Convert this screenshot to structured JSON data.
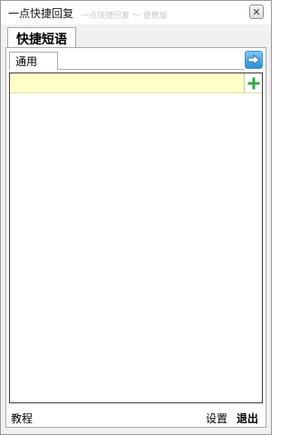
{
  "window": {
    "title": "一点快捷回复",
    "ghost_text": "一点快捷回复 ～ 便携版"
  },
  "outer_tab": {
    "label": "快捷短语"
  },
  "inner_tab": {
    "label": "通用"
  },
  "input": {
    "value": "",
    "placeholder": ""
  },
  "footer": {
    "tutorial": "教程",
    "settings": "设置",
    "quit": "退出"
  },
  "icons": {
    "close": "close-icon",
    "nav": "arrow-right-icon",
    "add": "plus-icon"
  },
  "colors": {
    "input_bg": "#ffffc8",
    "nav_button": "#2b8fd6",
    "add_icon": "#3aa64a"
  }
}
